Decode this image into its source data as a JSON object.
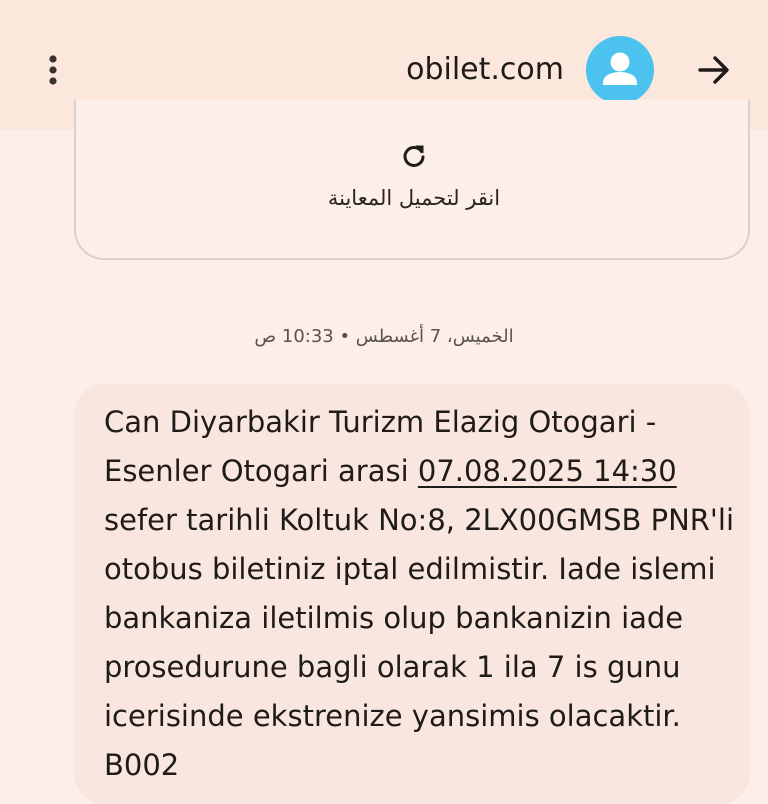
{
  "header": {
    "sender": "obilet.com",
    "icons": {
      "menu": "more-vert-icon",
      "avatar": "person-icon",
      "open": "arrow-forward-icon"
    },
    "avatar_color": "#4cc3ee"
  },
  "preview": {
    "label": "انقر لتحميل المعاينة",
    "icon": "refresh-icon"
  },
  "timestamp": "الخميس، 7 أغسطس • 10:33 ص",
  "message": {
    "text_before": "Can Diyarbakir Turizm Elazig Otogari - Esenler Otogari arasi ",
    "date_link": "07.08.2025 14:30",
    "text_after": " sefer tarihli Koltuk No:8, 2LX00GMSB PNR'li otobus biletiniz iptal edilmistir. Iade islemi bankaniza iletilmis olup bankanizin iade prosedurune bagli olarak 1 ila 7 is gunu icerisinde ekstrenize yansimis olacaktir. B002"
  }
}
